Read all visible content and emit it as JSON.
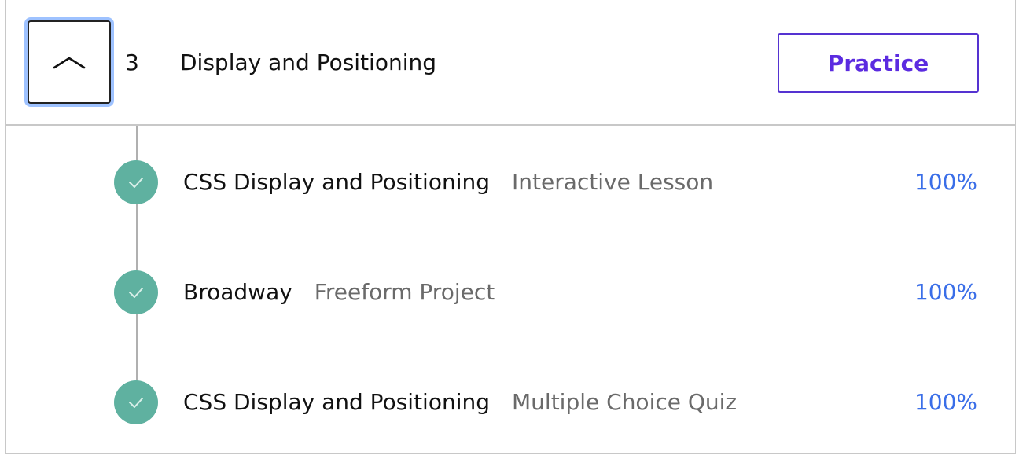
{
  "section": {
    "number": "3",
    "title": "Display and Positioning",
    "practice_label": "Practice",
    "toggle_icon": "chevron-up-icon"
  },
  "items": [
    {
      "title": "CSS Display and Positioning",
      "type": "Interactive Lesson",
      "progress": "100%"
    },
    {
      "title": "Broadway",
      "type": "Freeform Project",
      "progress": "100%"
    },
    {
      "title": "CSS Display and Positioning",
      "type": "Multiple Choice Quiz",
      "progress": "100%"
    }
  ],
  "colors": {
    "accent_purple": "#5b2be0",
    "check_green": "#5fb1a0",
    "progress_blue": "#3a6ee8",
    "focus_ring": "#9ec2ff"
  }
}
